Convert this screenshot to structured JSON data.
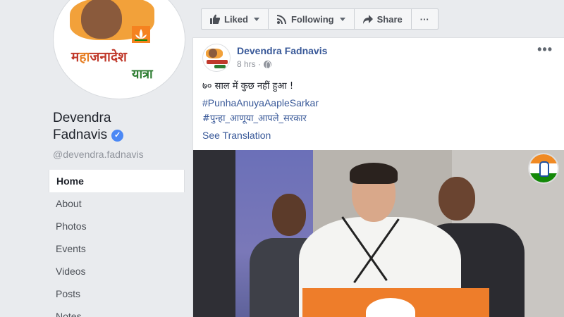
{
  "page": {
    "name_line1": "Devendra",
    "name_line2": "Fadnavis",
    "handle": "@devendra.fadnavis",
    "verified_mark": "✓",
    "logo": {
      "text_main": "जनादेश",
      "text_prefix": "म",
      "text_accent": "हा",
      "text_sub": "यात्रा"
    }
  },
  "nav": {
    "items": [
      {
        "label": "Home",
        "active": true
      },
      {
        "label": "About",
        "active": false
      },
      {
        "label": "Photos",
        "active": false
      },
      {
        "label": "Events",
        "active": false
      },
      {
        "label": "Videos",
        "active": false
      },
      {
        "label": "Posts",
        "active": false
      },
      {
        "label": "Notes",
        "active": false
      }
    ]
  },
  "actions": {
    "liked_label": "Liked",
    "following_label": "Following",
    "share_label": "Share",
    "more_label": "···"
  },
  "post": {
    "author": "Devendra Fadnavis",
    "time": "8 hrs · ",
    "more": "•••",
    "text": "७० साल में कुछ नहीं हुआ !",
    "hashtag1": "#PunhaAnuyaAapleSarkar",
    "hashtag2": "#पुन्हा_आणूया_आपले_सरकार",
    "see_translation": "See Translation"
  },
  "colors": {
    "link": "#385898",
    "bg": "#e9ebee",
    "verified": "#4b88f5"
  }
}
